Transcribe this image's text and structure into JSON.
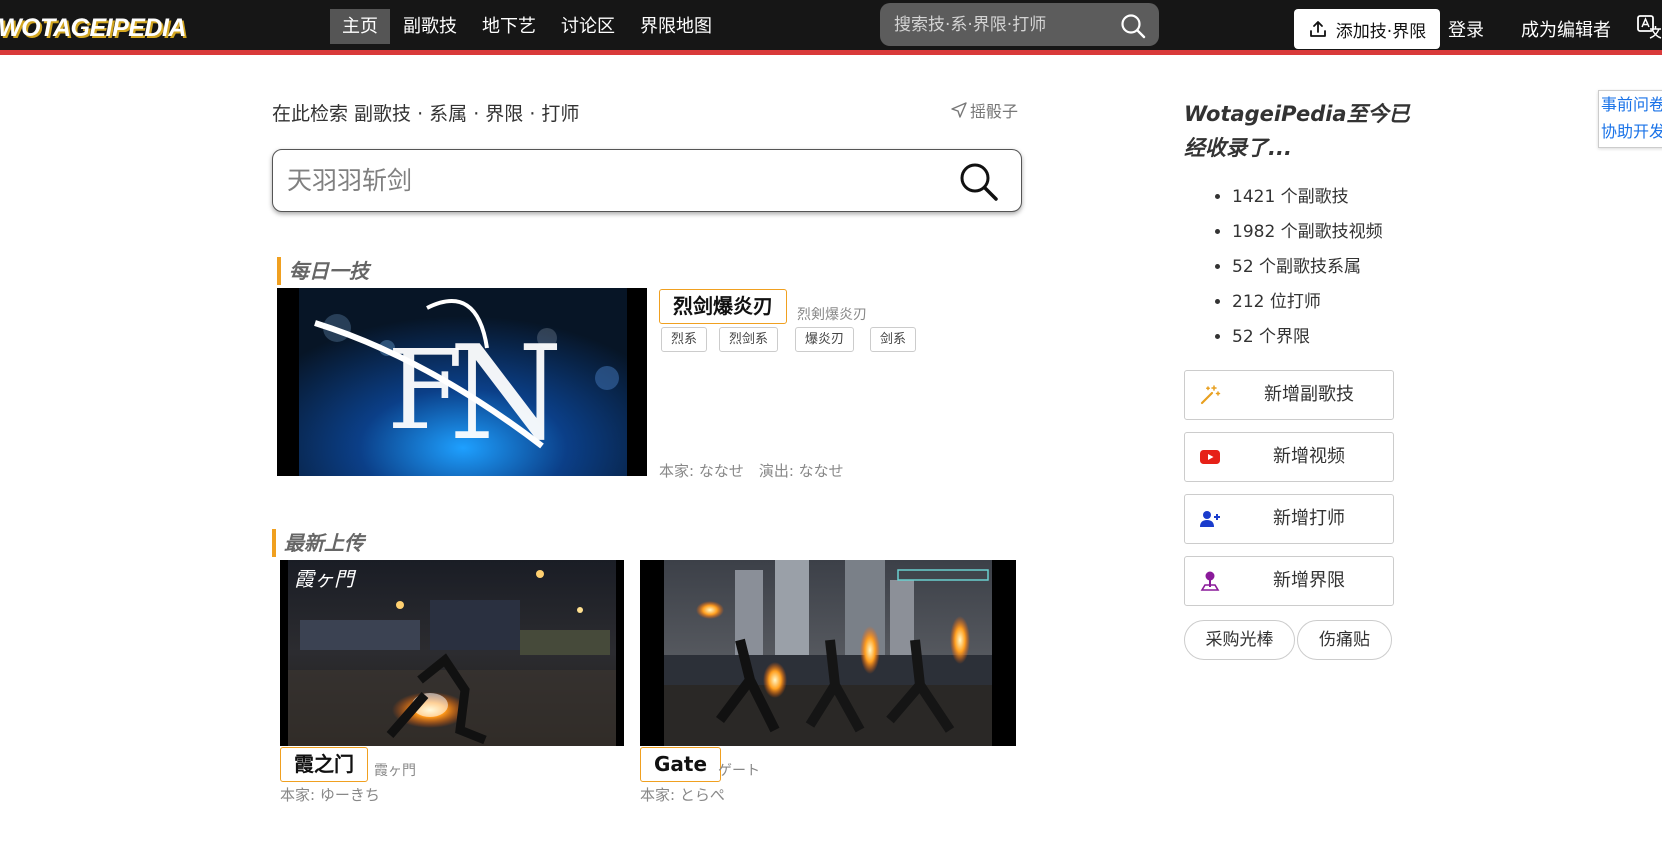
{
  "header": {
    "logo": "WOTAGEIPEDIA",
    "nav": [
      "主页",
      "副歌技",
      "地下艺",
      "讨论区",
      "界限地图"
    ],
    "search_placeholder": "搜索技·系·界限·打师",
    "add_button": "添加技·界限",
    "login": "登录",
    "become_editor": "成为编辑者"
  },
  "main": {
    "intro": "在此检索 副歌技 · 系属 · 界限 · 打师",
    "dice": "摇骰子",
    "search_placeholder": "天羽羽斩剑",
    "daily": {
      "section_title": "每日一技",
      "name": "烈剑爆炎刃",
      "original_name": "烈剣爆炎刃",
      "tags": [
        "烈系",
        "烈剑系",
        "爆炎刃",
        "剑系"
      ],
      "credit": "本家: ななせ　演出: ななせ"
    },
    "latest": {
      "section_title": "最新上传",
      "items": [
        {
          "name": "霞之门",
          "original_name": "霞ヶ門",
          "credit": "本家: ゆーきち",
          "caption": "霞ヶ門"
        },
        {
          "name": "Gate",
          "original_name": "ゲート",
          "credit": "本家: とらぺ"
        }
      ]
    }
  },
  "sidebar": {
    "title": "WotageiPedia至今已经收录了...",
    "stats": [
      "1421 个副歌技",
      "1982 个副歌技视频",
      "52 个副歌技系属",
      "212 位打师",
      "52 个界限"
    ],
    "actions": [
      "新增副歌技",
      "新增视频",
      "新增打师",
      "新增界限"
    ],
    "pills": [
      "采购光棒",
      "伤痛贴"
    ],
    "side_note": [
      "事前问卷",
      "协助开发"
    ]
  },
  "colors": {
    "header_bg": "#161616",
    "accent_red": "#d93a3a",
    "accent_orange": "#f0a020",
    "link_blue": "#1a73e8"
  }
}
